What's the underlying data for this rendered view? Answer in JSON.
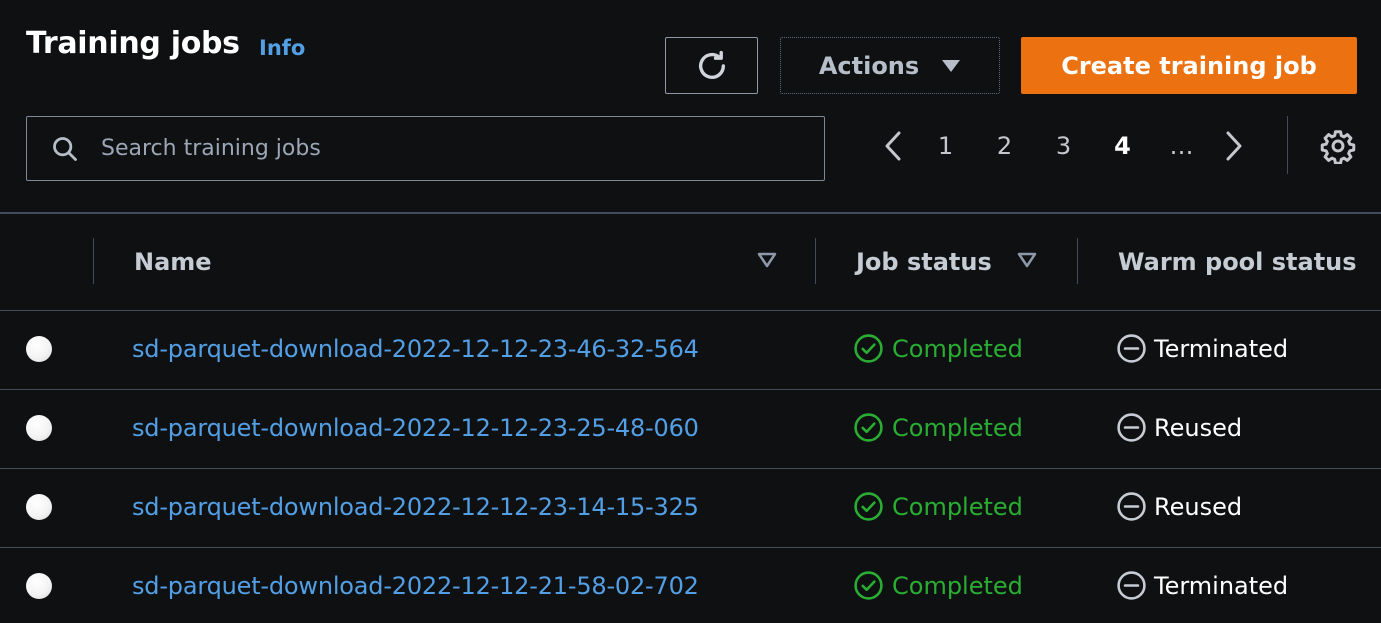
{
  "header": {
    "title": "Training jobs",
    "info_label": "Info"
  },
  "toolbar": {
    "refresh_icon": "refresh-icon",
    "actions_label": "Actions",
    "create_label": "Create training job"
  },
  "search": {
    "placeholder": "Search training jobs",
    "value": ""
  },
  "pagination": {
    "pages": [
      "1",
      "2",
      "3",
      "4",
      "…"
    ],
    "current_page": "4"
  },
  "table": {
    "columns": {
      "name": "Name",
      "job_status": "Job status",
      "warm_pool_status": "Warm pool status"
    },
    "rows": [
      {
        "name": "sd-parquet-download-2022-12-12-23-46-32-564",
        "job_status": "Completed",
        "warm_pool_status": "Terminated"
      },
      {
        "name": "sd-parquet-download-2022-12-12-23-25-48-060",
        "job_status": "Completed",
        "warm_pool_status": "Reused"
      },
      {
        "name": "sd-parquet-download-2022-12-12-23-14-15-325",
        "job_status": "Completed",
        "warm_pool_status": "Reused"
      },
      {
        "name": "sd-parquet-download-2022-12-12-21-58-02-702",
        "job_status": "Completed",
        "warm_pool_status": "Terminated"
      }
    ]
  },
  "colors": {
    "background": "#0f1012",
    "link": "#539fe5",
    "primary_button": "#ec7211",
    "success": "#29ad32",
    "divider": "#414d5c"
  }
}
